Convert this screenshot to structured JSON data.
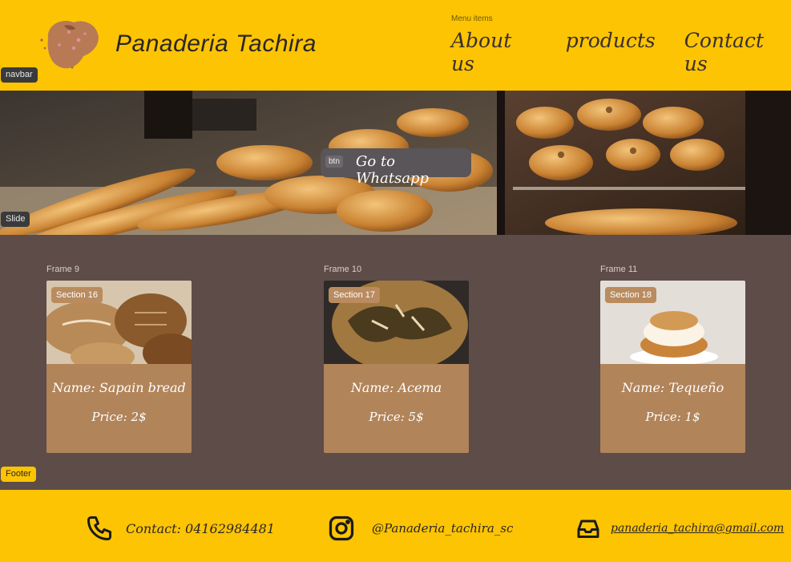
{
  "header": {
    "brand": "Panaderia Tachira",
    "menu_caption": "Menu items",
    "nav": [
      "About us",
      "products",
      "Contact  us"
    ],
    "navbar_tag": "navbar"
  },
  "slide": {
    "tag": "Slide",
    "button_chip": "btn",
    "button_label": "Go to Whatsapp"
  },
  "products": [
    {
      "frame": "Frame 9",
      "section": "Section 16",
      "name": "Name: Sapain bread",
      "price": "Price: 2$"
    },
    {
      "frame": "Frame 10",
      "section": "Section 17",
      "name": "Name: Acema",
      "price": "Price: 5$"
    },
    {
      "frame": "Frame 11",
      "section": "Section 18",
      "name": "Name: Tequeño",
      "price": "Price: 1$"
    }
  ],
  "footer": {
    "tag": "Footer",
    "contact": "Contact: 04162984481",
    "instagram": "@Panaderia_tachira_sc",
    "email": "panaderia_tachira@gmail.com"
  },
  "colors": {
    "header_bg": "#fcc403",
    "body_bg": "#5d4c47",
    "card_bg": "#b1845a"
  },
  "icons": [
    "logo-bread-icon",
    "phone-icon",
    "instagram-icon",
    "inbox-icon"
  ]
}
